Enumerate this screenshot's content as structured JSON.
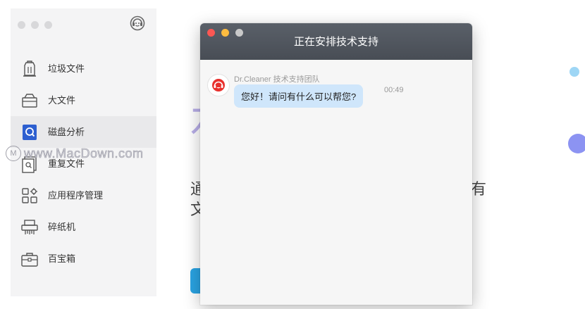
{
  "sidebar": {
    "items": [
      {
        "label": "垃圾文件",
        "icon": "trash-bag-icon"
      },
      {
        "label": "大文件",
        "icon": "file-box-icon"
      },
      {
        "label": "磁盘分析",
        "icon": "disk-analysis-icon",
        "active": true
      },
      {
        "label": "重复文件",
        "icon": "duplicate-file-icon"
      },
      {
        "label": "应用程序管理",
        "icon": "app-manager-icon"
      },
      {
        "label": "碎纸机",
        "icon": "shredder-icon"
      },
      {
        "label": "百宝箱",
        "icon": "toolbox-icon"
      }
    ]
  },
  "watermark": {
    "text": "www.MacDown.com"
  },
  "background": {
    "big_char": "石",
    "line1_left": "通",
    "line1_right": "有",
    "line2": "文"
  },
  "dialog": {
    "title": "正在安排技术支持",
    "message": {
      "sender": "Dr.Cleaner 技术支持团队",
      "text": "您好！请问有什么可以帮您?",
      "time": "00:49"
    }
  },
  "colors": {
    "accent_purple": "#b8aee8",
    "accent_blue": "#2aa3e2",
    "bubble": "#cfe6fb",
    "titlebar": "#4f545c",
    "avatar_red": "#e8302d"
  }
}
